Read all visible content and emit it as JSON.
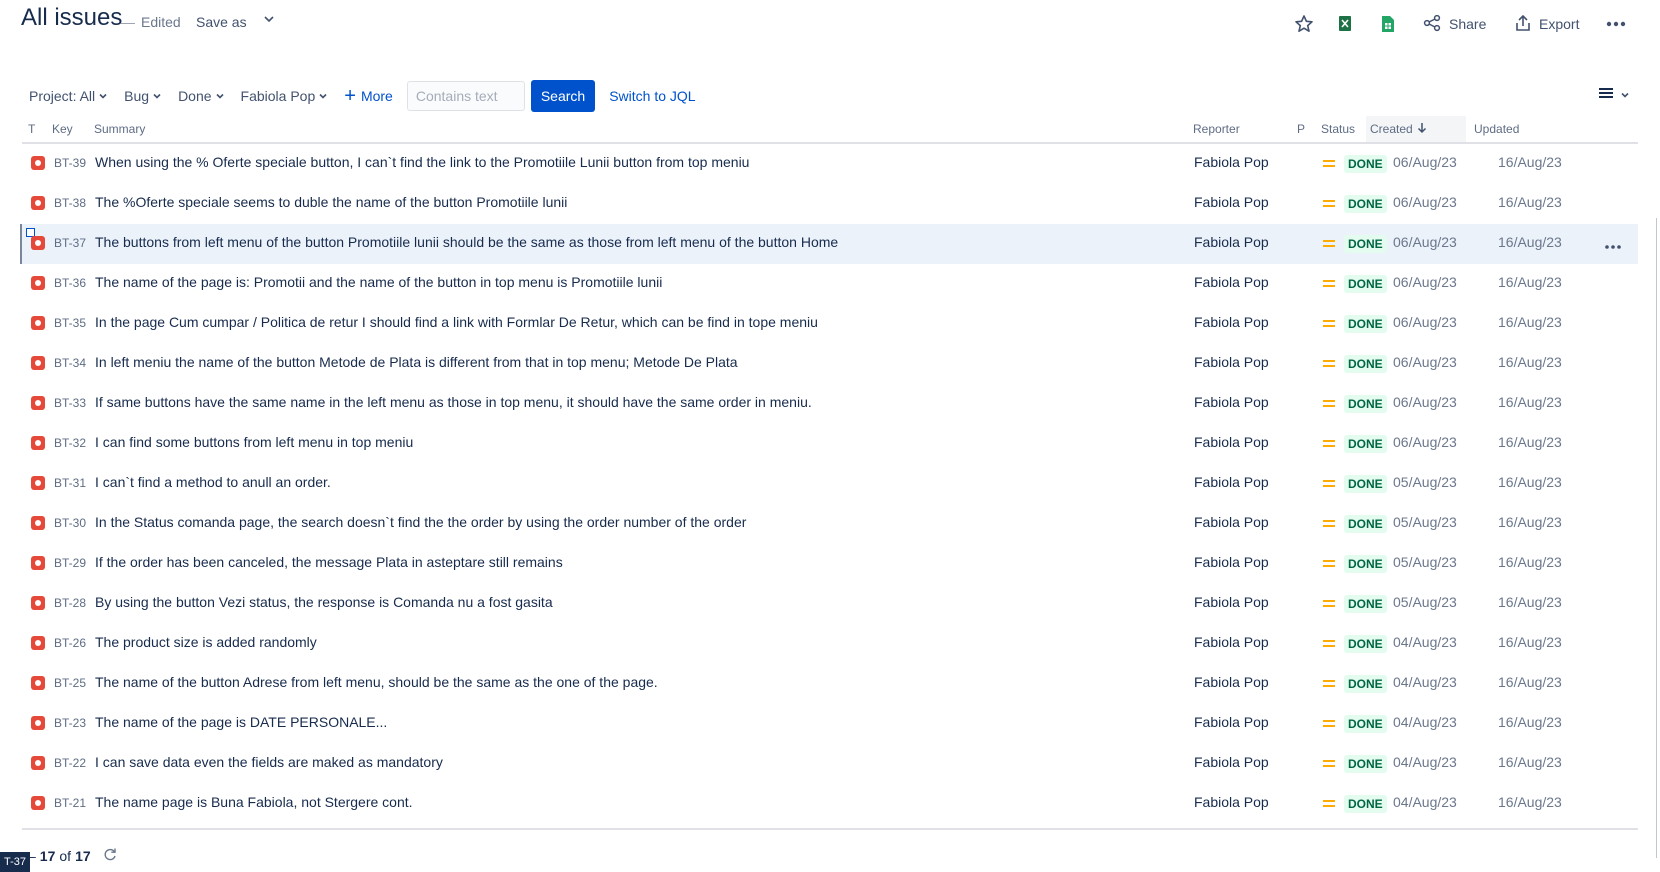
{
  "header": {
    "title": "All issues",
    "edited": "Edited",
    "save_as": "Save as",
    "share": "Share",
    "export": "Export"
  },
  "icons": {
    "star": "star-icon",
    "excel": "excel-icon",
    "sheets": "sheets-icon",
    "share": "share-icon",
    "export": "export-icon",
    "more": "more-icon"
  },
  "filters": {
    "project": "Project: All",
    "type": "Bug",
    "status": "Done",
    "assignee": "Fabiola Pop",
    "more": "More",
    "text_placeholder": "Contains text",
    "search": "Search",
    "switch_jql": "Switch to JQL"
  },
  "columns": {
    "type": "T",
    "key": "Key",
    "summary": "Summary",
    "reporter": "Reporter",
    "priority": "P",
    "status": "Status",
    "created": "Created",
    "updated": "Updated"
  },
  "issues": [
    {
      "key": "BT-39",
      "summary": "When using the % Oferte speciale button, I can`t find the link to the Promotiile Lunii button from top meniu",
      "reporter": "Fabiola Pop",
      "status": "DONE",
      "created": "06/Aug/23",
      "updated": "16/Aug/23"
    },
    {
      "key": "BT-38",
      "summary": "The %Oferte speciale seems to duble the name of the button Promotiile lunii",
      "reporter": "Fabiola Pop",
      "status": "DONE",
      "created": "06/Aug/23",
      "updated": "16/Aug/23"
    },
    {
      "key": "BT-37",
      "summary": "The buttons from left menu of the button Promotiile lunii should be the same as those from left menu of the button Home",
      "reporter": "Fabiola Pop",
      "status": "DONE",
      "created": "06/Aug/23",
      "updated": "16/Aug/23"
    },
    {
      "key": "BT-36",
      "summary": "The name of the page is: Promotii and the name of the button in top menu is Promotiile lunii",
      "reporter": "Fabiola Pop",
      "status": "DONE",
      "created": "06/Aug/23",
      "updated": "16/Aug/23"
    },
    {
      "key": "BT-35",
      "summary": "In the page Cum cumpar / Politica de retur I should find a link with Formlar De Retur, which can be find in tope meniu",
      "reporter": "Fabiola Pop",
      "status": "DONE",
      "created": "06/Aug/23",
      "updated": "16/Aug/23"
    },
    {
      "key": "BT-34",
      "summary": "In left meniu the name of the button Metode de Plata is different from that in top menu; Metode De Plata",
      "reporter": "Fabiola Pop",
      "status": "DONE",
      "created": "06/Aug/23",
      "updated": "16/Aug/23"
    },
    {
      "key": "BT-33",
      "summary": "If same buttons have the same name in the left menu as those in top menu, it should have the same order in meniu.",
      "reporter": "Fabiola Pop",
      "status": "DONE",
      "created": "06/Aug/23",
      "updated": "16/Aug/23"
    },
    {
      "key": "BT-32",
      "summary": "I can find some buttons from left menu in top meniu",
      "reporter": "Fabiola Pop",
      "status": "DONE",
      "created": "06/Aug/23",
      "updated": "16/Aug/23"
    },
    {
      "key": "BT-31",
      "summary": "I can`t find a method to anull an order.",
      "reporter": "Fabiola Pop",
      "status": "DONE",
      "created": "05/Aug/23",
      "updated": "16/Aug/23"
    },
    {
      "key": "BT-30",
      "summary": "In the Status comanda page, the search doesn`t find the the order by using the order number of the order",
      "reporter": "Fabiola Pop",
      "status": "DONE",
      "created": "05/Aug/23",
      "updated": "16/Aug/23"
    },
    {
      "key": "BT-29",
      "summary": "If the order has been canceled, the message Plata in asteptare still remains",
      "reporter": "Fabiola Pop",
      "status": "DONE",
      "created": "05/Aug/23",
      "updated": "16/Aug/23"
    },
    {
      "key": "BT-28",
      "summary": "By using the button Vezi status, the response is Comanda nu a fost gasita",
      "reporter": "Fabiola Pop",
      "status": "DONE",
      "created": "05/Aug/23",
      "updated": "16/Aug/23"
    },
    {
      "key": "BT-26",
      "summary": "The product size is added randomly",
      "reporter": "Fabiola Pop",
      "status": "DONE",
      "created": "04/Aug/23",
      "updated": "16/Aug/23"
    },
    {
      "key": "BT-25",
      "summary": "The name of the button Adrese from left menu, should be the same as the one of the page.",
      "reporter": "Fabiola Pop",
      "status": "DONE",
      "created": "04/Aug/23",
      "updated": "16/Aug/23"
    },
    {
      "key": "BT-23",
      "summary": "The name of the page is DATE PERSONALE...",
      "reporter": "Fabiola Pop",
      "status": "DONE",
      "created": "04/Aug/23",
      "updated": "16/Aug/23"
    },
    {
      "key": "BT-22",
      "summary": "I can save data even the fields are maked as mandatory",
      "reporter": "Fabiola Pop",
      "status": "DONE",
      "created": "04/Aug/23",
      "updated": "16/Aug/23"
    },
    {
      "key": "BT-21",
      "summary": "The name page is Buna Fabiola, not Stergere cont.",
      "reporter": "Fabiola Pop",
      "status": "DONE",
      "created": "04/Aug/23",
      "updated": "16/Aug/23"
    }
  ],
  "selected_key": "BT-37",
  "pager": {
    "range_prefix": "–",
    "shown": "17",
    "of": "of",
    "total": "17"
  },
  "tooltip": "T-37",
  "colors": {
    "accent": "#0052cc",
    "bug": "#e5493a",
    "priority_medium": "#ffab00",
    "done_bg": "#e3fcef",
    "done_text": "#006644"
  }
}
